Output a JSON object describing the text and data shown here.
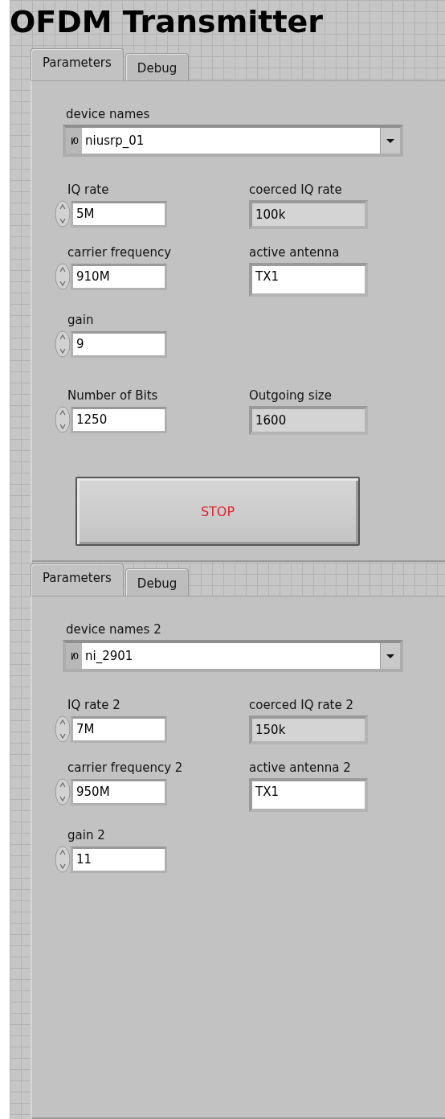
{
  "title": "OFDM Transmitter",
  "panels": [
    {
      "tabs": [
        {
          "label": "Parameters",
          "selected": true
        },
        {
          "label": "Debug",
          "selected": false
        }
      ],
      "device": {
        "label": "device names",
        "io_glyph": "I/0",
        "value": "niusrp_01"
      },
      "rows": [
        {
          "left": {
            "label": "IQ rate",
            "value": "5M",
            "kind": "numeric"
          },
          "right": {
            "label": "coerced IQ rate",
            "value": "100k",
            "kind": "indicator"
          }
        },
        {
          "left": {
            "label": "carrier frequency",
            "value": "910M",
            "kind": "numeric"
          },
          "right": {
            "label": "active antenna",
            "value": "TX1",
            "kind": "string"
          }
        },
        {
          "left": {
            "label": "gain",
            "value": "9",
            "kind": "numeric"
          }
        },
        {
          "left": {
            "label": "Number of Bits",
            "value": "1250",
            "kind": "numeric"
          },
          "right": {
            "label": "Outgoing size",
            "value": "1600",
            "kind": "indicator"
          }
        }
      ],
      "stop_button": "STOP"
    },
    {
      "tabs": [
        {
          "label": "Parameters",
          "selected": true
        },
        {
          "label": "Debug",
          "selected": false
        }
      ],
      "device": {
        "label": "device names 2",
        "io_glyph": "I/0",
        "value": "ni_2901"
      },
      "rows": [
        {
          "left": {
            "label": "IQ rate 2",
            "value": "7M",
            "kind": "numeric"
          },
          "right": {
            "label": "coerced IQ rate 2",
            "value": "150k",
            "kind": "indicator"
          }
        },
        {
          "left": {
            "label": "carrier frequency 2",
            "value": "950M",
            "kind": "numeric"
          },
          "right": {
            "label": "active antenna 2",
            "value": "TX1",
            "kind": "string"
          }
        },
        {
          "left": {
            "label": "gain 2",
            "value": "11",
            "kind": "numeric"
          }
        }
      ]
    }
  ]
}
